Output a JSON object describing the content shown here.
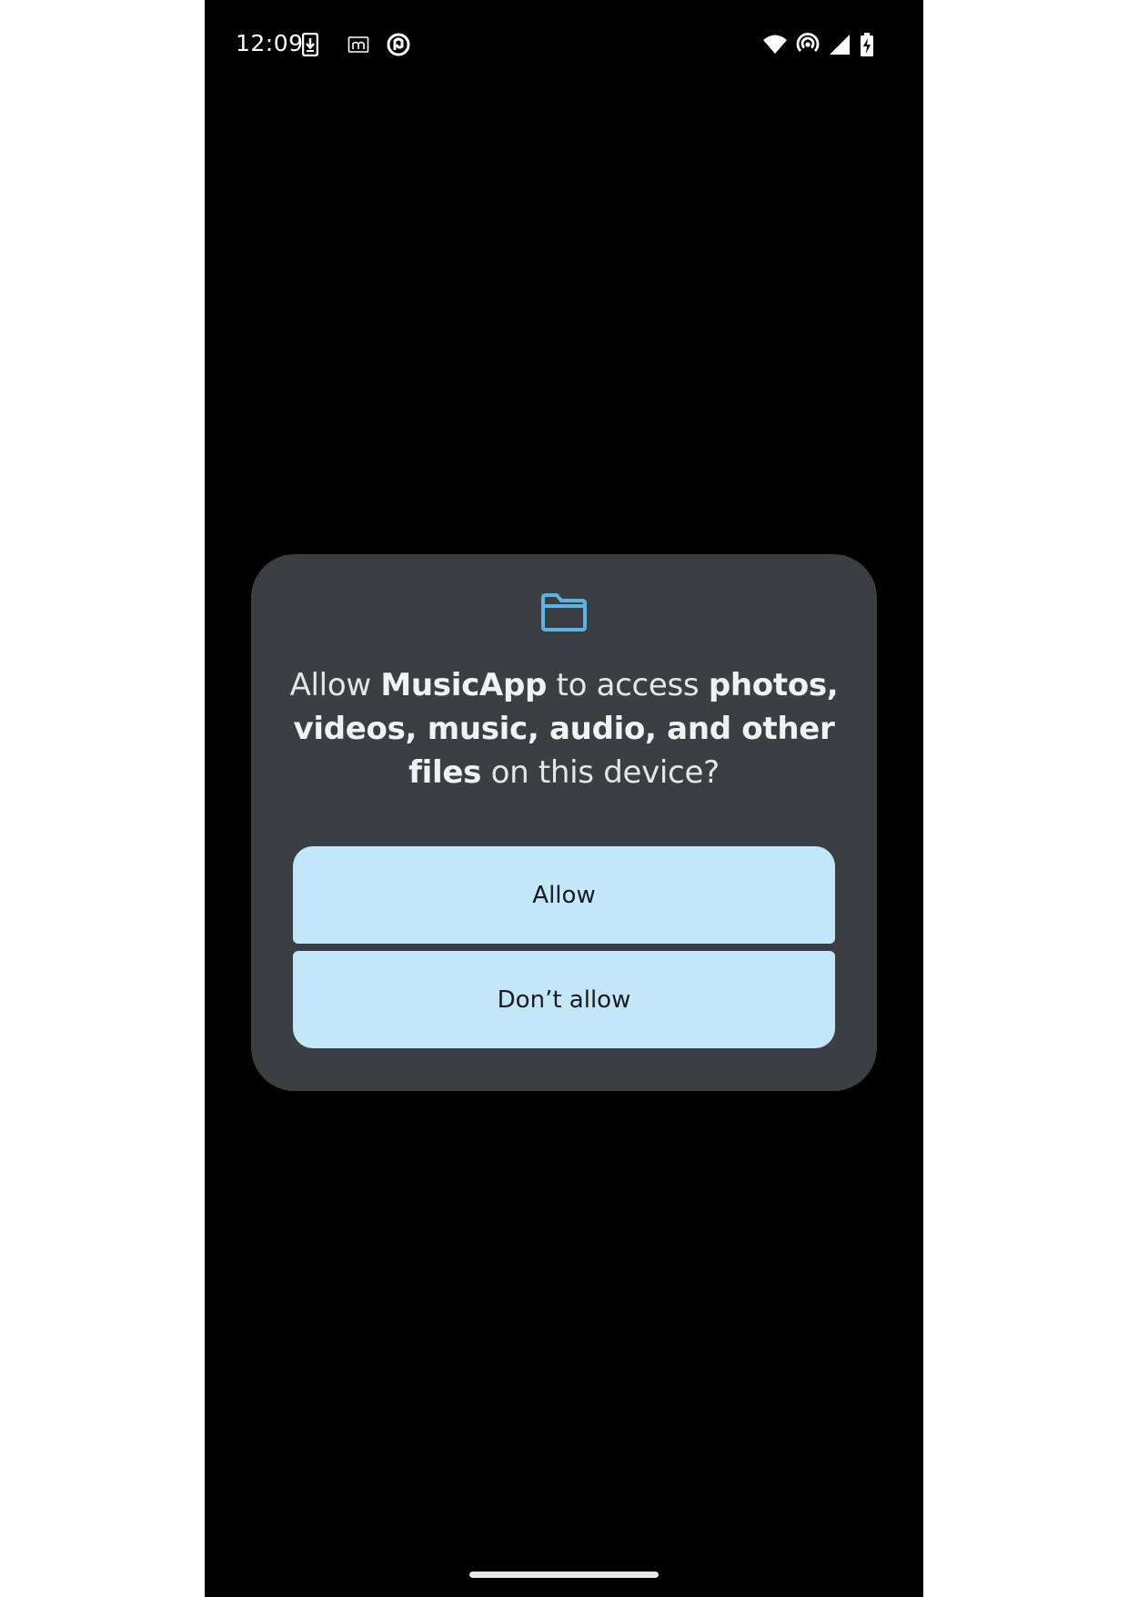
{
  "status_bar": {
    "time": "12:09",
    "left_icons": [
      "download-notification-icon",
      "m-app-notification-icon",
      "sync-app-notification-icon"
    ],
    "right_icons": [
      "wifi-icon",
      "hotspot-icon",
      "cell-signal-icon",
      "battery-charging-icon"
    ]
  },
  "dialog": {
    "icon": "folder-icon",
    "icon_color": "#5ab4e6",
    "title_parts": {
      "p1": "Allow ",
      "app_name": "MusicApp",
      "p2": " to access ",
      "resources": "photos, videos, music, audio, and other files",
      "p3": " on this device?"
    },
    "buttons": {
      "allow": "Allow",
      "deny": "Don’t allow"
    }
  },
  "colors": {
    "screen_background": "#000000",
    "dialog_background": "#3b3f42",
    "button_background": "#c2e7fb"
  }
}
